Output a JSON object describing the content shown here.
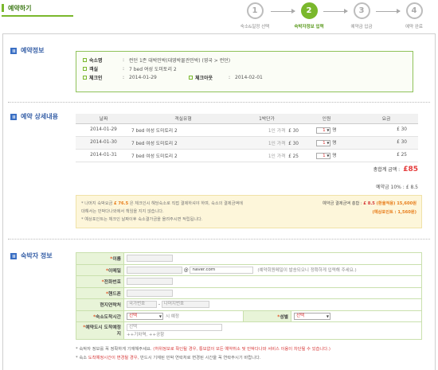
{
  "page_title": "예약하기",
  "steps": [
    {
      "num": "1",
      "label": "숙소&일정 선택"
    },
    {
      "num": "2",
      "label": "숙박자정보 입력"
    },
    {
      "num": "3",
      "label": "예약금 입금"
    },
    {
      "num": "4",
      "label": "예약 완료"
    }
  ],
  "booking_info": {
    "section_title": "예약정보",
    "lodging_key": "숙소명",
    "lodging_value": "런던 1존 대박민박(대영박물관민박) (영국 > 런던)",
    "room_key": "객실",
    "room_value": "7 bed 여성 도미토리 2",
    "checkin_key": "체크인",
    "checkin_value": "2014-01-29",
    "checkout_key": "체크아웃",
    "checkout_value": "2014-02-01"
  },
  "detail": {
    "section_title": "예약 상세내용",
    "headers": [
      "날짜",
      "객실유형",
      "1박단가",
      "인원",
      "요금"
    ],
    "rows": [
      {
        "date": "2014-01-29",
        "room": "7 bed 여성 도미토리 2",
        "unit_label": "1인 가격",
        "unit_price": "£ 30",
        "count": "1",
        "count_unit": "명",
        "fee": "£ 30"
      },
      {
        "date": "2014-01-30",
        "room": "7 bed 여성 도미토리 2",
        "unit_label": "1인 가격",
        "unit_price": "£ 30",
        "count": "1",
        "count_unit": "명",
        "fee": "£ 30"
      },
      {
        "date": "2014-01-31",
        "room": "7 bed 여성 도미토리 2",
        "unit_label": "1인 가격",
        "unit_price": "£ 25",
        "count": "1",
        "count_unit": "명",
        "fee": "£ 25"
      }
    ],
    "total_label": "총합계 금액 :",
    "total_value": "£85",
    "deposit_label": "예약금 10% :",
    "deposit_value": "£ 8.5"
  },
  "payment": {
    "note1_a": "* 나머지 숙박요금",
    "note1_b": "£ 76.5",
    "note1_c": "은 체크인시 해당숙소로 직접 결제하셔야 하며, 숙소의 결제금액에 대해서는 민박다나와에서 책임을 지지 않습니다.",
    "note2": "* 예상포인트는 체크인 날짜이후 숙소결가금을 올려주시면 적립됩니다.",
    "pay_label": "예약금 결제금액 총합 :",
    "pay_value": "£ 8.5",
    "pay_won": "(환율적용) 15,600원",
    "points": "(예상포인트 : 1,560원)"
  },
  "guest": {
    "section_title": "숙박자 정보",
    "name_label": "이름",
    "email_label": "이메일",
    "email_domain": "naver.com",
    "email_hint": "(예약회원메일이 발송되오니 정확하게 입력해 주세요.)",
    "phone_label": "전화번호",
    "mobile_label": "핸드폰",
    "local_label": "현지연락처",
    "local_country_ph": "국가번호",
    "local_rest_ph": "나머지번호",
    "arrival_label": "숙소도착시간",
    "arrival_select": "선택",
    "arrival_hint": "시 예정",
    "gender_label": "성별",
    "gender_select": "선택",
    "pickup_label": "예약도시 도착예정지",
    "pickup_select": "선택",
    "pickup_hint": "++기차역, ++공항"
  },
  "notes": {
    "line1_a": "* 숙박자 정보를 꼭 정확하게 기재해주세요.",
    "line1_b": "(허위정보로 확인될 경우, 통보없이 모든 예약취소 및 민박다나와 서비스 이용이 차단될 수 있습니다.)",
    "line2_a": "* 숙소",
    "line2_b": "도착예정시간이 변경될 경우,",
    "line2_c": "반드시 기재된 민박 연락처로 변경된 시간을 꼭 연락주시기 바랍니다."
  }
}
